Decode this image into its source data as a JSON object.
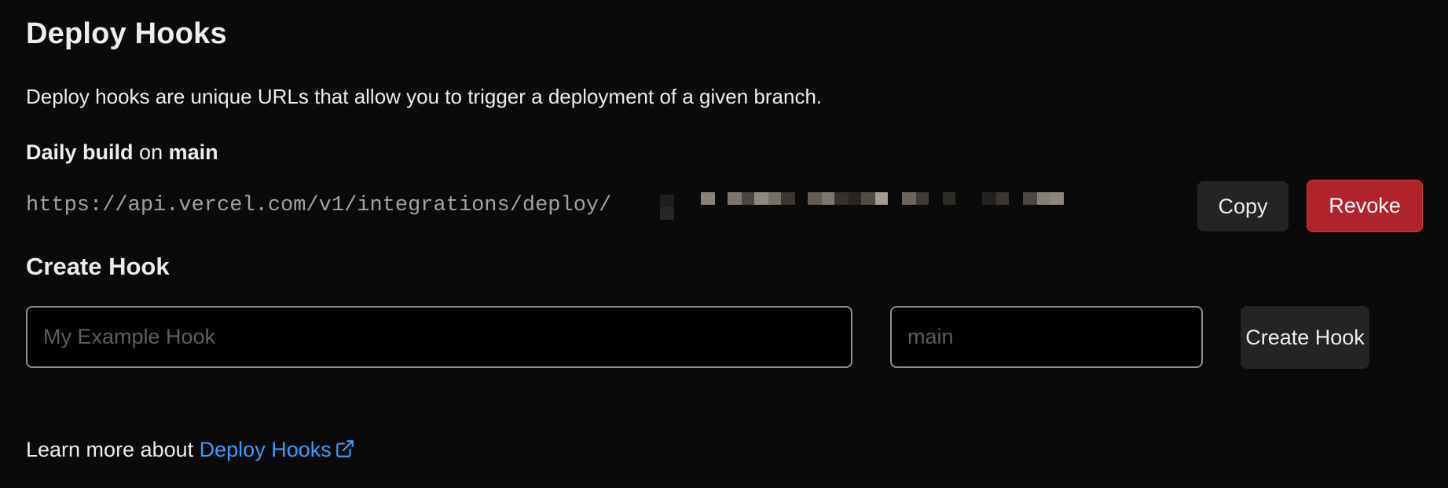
{
  "section": {
    "title": "Deploy Hooks",
    "description": "Deploy hooks are unique URLs that allow you to trigger a deployment of a given branch."
  },
  "hook": {
    "name": "Daily build",
    "on_label": "on",
    "branch": "main",
    "url_prefix": "https://api.vercel.com/v1/integrations/deploy/",
    "copy_label": "Copy",
    "revoke_label": "Revoke"
  },
  "create": {
    "title": "Create Hook",
    "name_placeholder": "My Example Hook",
    "branch_placeholder": "main",
    "button_label": "Create Hook"
  },
  "footer": {
    "learn_more_text": "Learn more about",
    "link_text": "Deploy Hooks",
    "link_icon": "external-link-icon"
  },
  "colors": {
    "background": "#0a0a0a",
    "text": "#ededed",
    "muted": "#a1a1a1",
    "danger": "#b0232b",
    "link": "#3d9cf5",
    "button_secondary": "#242424"
  }
}
